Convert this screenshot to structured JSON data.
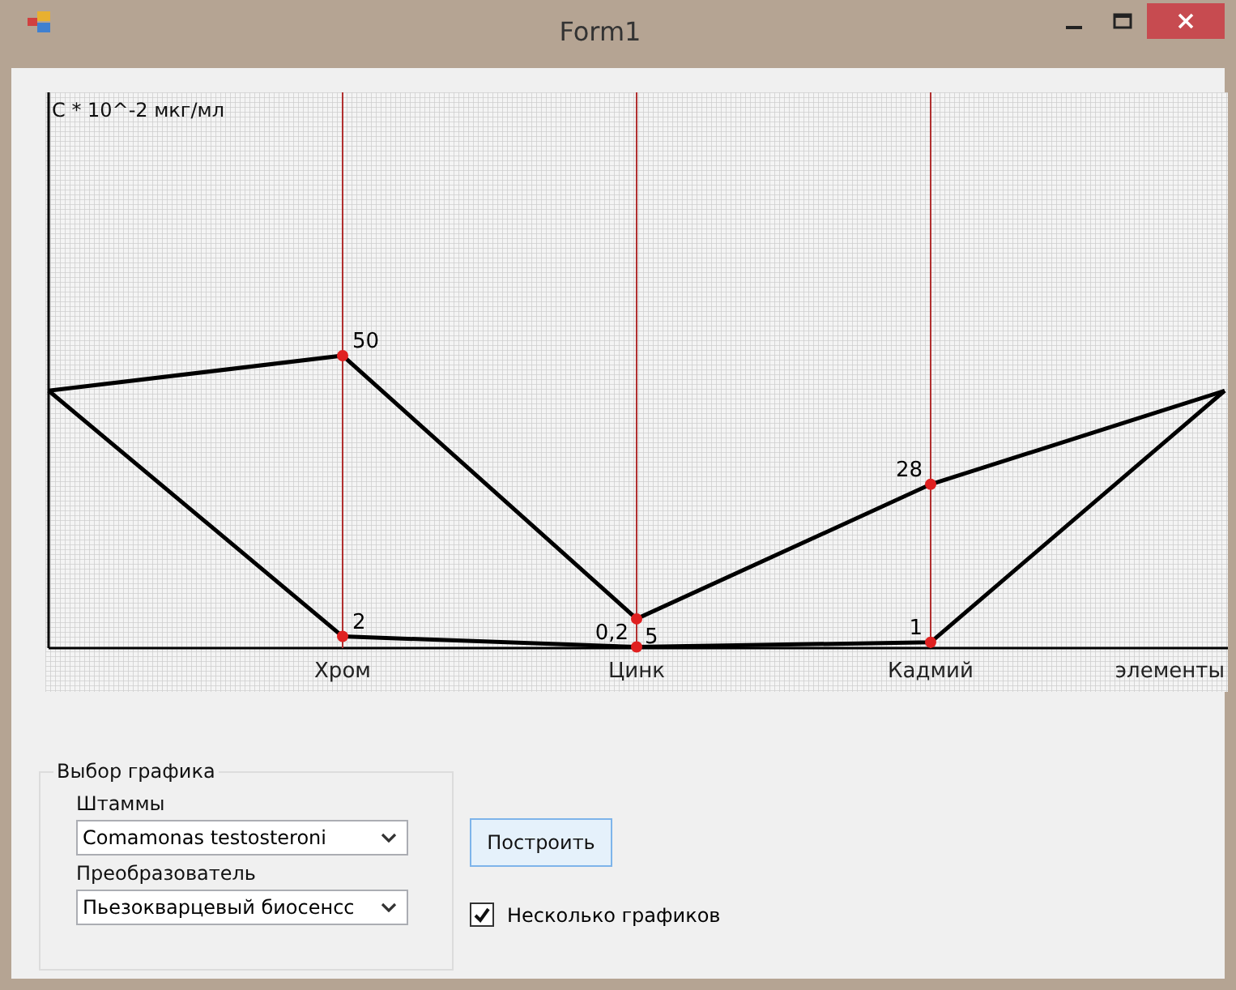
{
  "window": {
    "title": "Form1"
  },
  "chart": {
    "chart_data": {
      "type": "line",
      "ylabel": "C * 10^-2 мкг/мл",
      "xlabel": "элементы",
      "categories": [
        null,
        "Хром",
        "Цинк",
        "Кадмий",
        null
      ],
      "ylim": [
        0,
        95
      ],
      "data_labels": true,
      "grid": true,
      "series": [
        {
          "color": "#000000",
          "marker": "circle",
          "values": [
            44,
            50,
            5,
            28,
            44
          ],
          "value_labels": [
            null,
            "50",
            "5",
            "28",
            null
          ]
        },
        {
          "color": "#000000",
          "marker": "circle",
          "values": [
            44,
            2,
            0.2,
            1,
            44
          ],
          "value_labels": [
            null,
            "2",
            "0,2",
            "1",
            null
          ]
        }
      ]
    }
  },
  "group": {
    "title": "Выбор графика",
    "fields": [
      {
        "label": "Штаммы",
        "value": "Comamonas testosteroni"
      },
      {
        "label": "Преобразователь",
        "value": "Пьезокварцевый биосенсс"
      }
    ]
  },
  "build_button": "Построить",
  "multi_checkbox": {
    "label": "Несколько графиков",
    "checked": true
  }
}
